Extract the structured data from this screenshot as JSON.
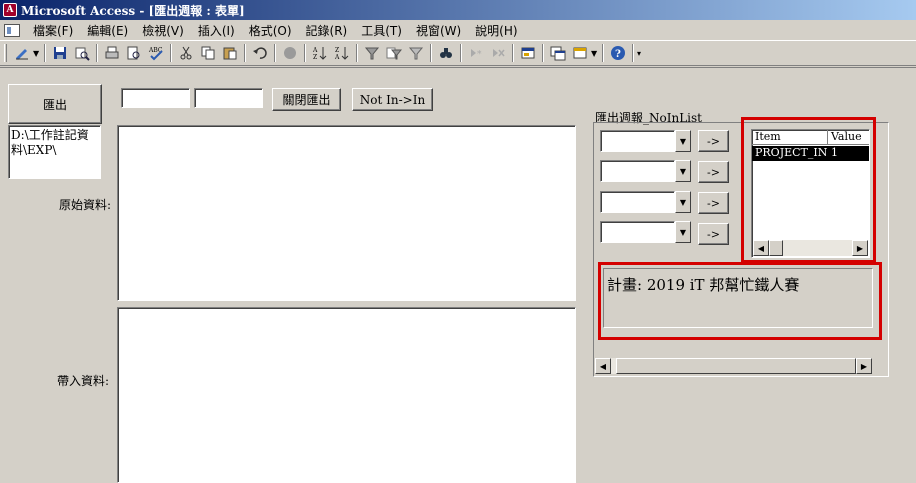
{
  "window": {
    "title": "Microsoft Access - [匯出週報 : 表單]"
  },
  "menu": {
    "items": [
      "檔案(F)",
      "編輯(E)",
      "檢視(V)",
      "插入(I)",
      "格式(O)",
      "記錄(R)",
      "工具(T)",
      "視窗(W)",
      "說明(H)"
    ]
  },
  "toolbar": {
    "icons": [
      "design-view-icon",
      "save-icon",
      "search-icon",
      "print-icon",
      "print-preview-icon",
      "spell-check-icon",
      "cut-icon",
      "copy-icon",
      "paste-icon",
      "undo-icon",
      "hyperlink-icon",
      "sort-ascending-icon",
      "sort-descending-icon",
      "filter-by-selection-icon",
      "filter-by-form-icon",
      "apply-filter-icon",
      "find-icon",
      "new-record-icon",
      "delete-record-icon",
      "properties-icon",
      "database-window-icon",
      "new-object-icon",
      "help-icon"
    ]
  },
  "form": {
    "export_button": "匯出",
    "close_export_button": "關閉匯出",
    "not_in_button": "Not In->In",
    "path_text": "D:\\工作註記資料\\EXP\\",
    "original_data_label": "原始資料:",
    "import_data_label": "帶入資料:",
    "group_label": "匯出週報_NoInList",
    "arrow_buttons": [
      "->",
      "->",
      "->",
      "->"
    ],
    "list": {
      "columns": [
        "Item",
        "Value"
      ],
      "rows": [
        {
          "item": "PROJECT_INI",
          "value": "1"
        }
      ]
    },
    "project_text": "計畫: 2019 iT 邦幫忙鐵人賽"
  },
  "colors": {
    "highlight": "#d40000",
    "title_bar": "#0a246a",
    "selection": "#000000"
  }
}
